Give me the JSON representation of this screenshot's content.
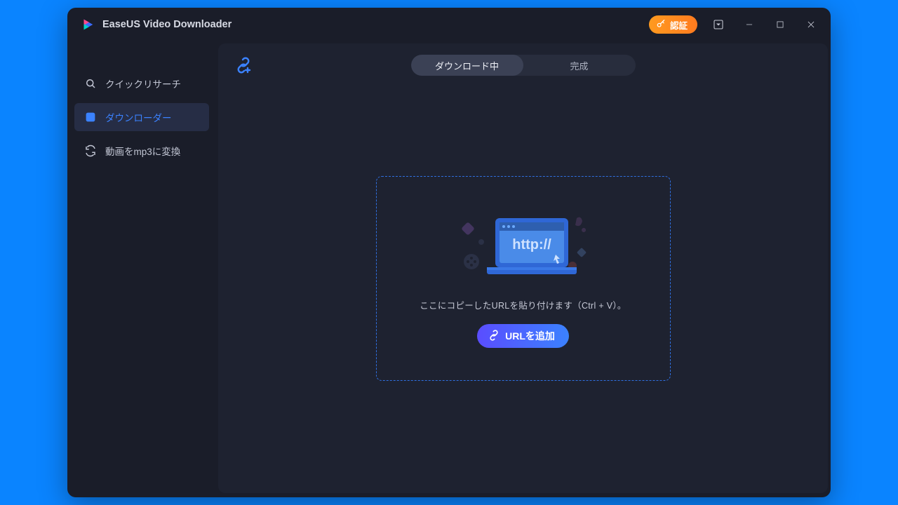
{
  "app": {
    "title": "EaseUS Video Downloader"
  },
  "titlebar": {
    "cert_label": "認証"
  },
  "sidebar": {
    "items": [
      {
        "label": "クイックリサーチ"
      },
      {
        "label": "ダウンローダー"
      },
      {
        "label": "動画をmp3に変換"
      }
    ]
  },
  "tabs": {
    "downloading": "ダウンロード中",
    "completed": "完成"
  },
  "dropzone": {
    "hint": "ここにコピーしたURLを貼り付けます（Ctrl + V）。",
    "add_url_label": "URLを追加",
    "illust_text": "http://"
  }
}
